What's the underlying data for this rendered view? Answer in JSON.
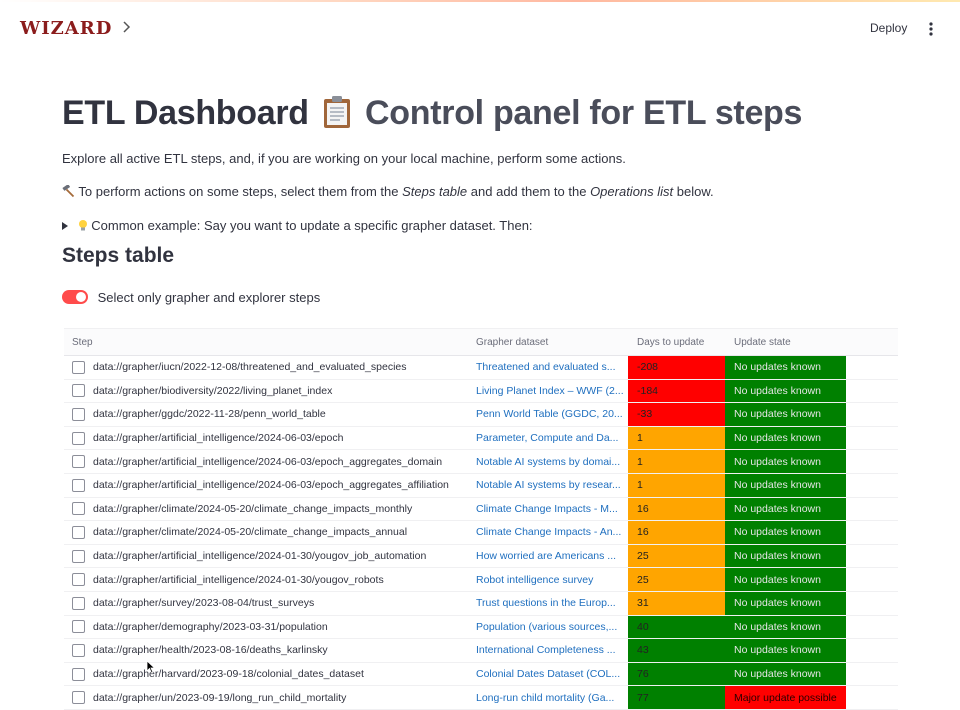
{
  "app": {
    "logo": "WIZARD",
    "deploy_label": "Deploy"
  },
  "page": {
    "title_left": "ETL Dashboard",
    "title_right": "Control panel for ETL steps",
    "intro": "Explore all active ETL steps, and, if you are working on your local machine, perform some actions.",
    "actions_prefix": "To perform actions on some steps, select them from the",
    "actions_steps_table": "Steps table",
    "actions_middle": "and add them to the",
    "actions_operations_list": "Operations list",
    "actions_suffix": "below.",
    "expander_label": "Common example: Say you want to update a specific grapher dataset. Then:",
    "steps_heading": "Steps table",
    "toggle_label": "Select only grapher and explorer steps",
    "toggle_on": true
  },
  "table": {
    "columns": [
      "Step",
      "Grapher dataset",
      "Days to update",
      "Update state"
    ],
    "rows": [
      {
        "step": "data://grapher/iucn/2022-12-08/threatened_and_evaluated_species",
        "grapher": "Threatened and evaluated s...",
        "days": "-208",
        "days_color": "#ff0000",
        "state": "No updates known",
        "state_color": "#008000"
      },
      {
        "step": "data://grapher/biodiversity/2022/living_planet_index",
        "grapher": "Living Planet Index – WWF (2...",
        "days": "-184",
        "days_color": "#ff0000",
        "state": "No updates known",
        "state_color": "#008000"
      },
      {
        "step": "data://grapher/ggdc/2022-11-28/penn_world_table",
        "grapher": "Penn World Table (GGDC, 20...",
        "days": "-33",
        "days_color": "#ff0000",
        "state": "No updates known",
        "state_color": "#008000"
      },
      {
        "step": "data://grapher/artificial_intelligence/2024-06-03/epoch",
        "grapher": "Parameter, Compute and Da...",
        "days": "1",
        "days_color": "#ffa500",
        "state": "No updates known",
        "state_color": "#008000"
      },
      {
        "step": "data://grapher/artificial_intelligence/2024-06-03/epoch_aggregates_domain",
        "grapher": "Notable AI systems by domai...",
        "days": "1",
        "days_color": "#ffa500",
        "state": "No updates known",
        "state_color": "#008000"
      },
      {
        "step": "data://grapher/artificial_intelligence/2024-06-03/epoch_aggregates_affiliation",
        "grapher": "Notable AI systems by resear...",
        "days": "1",
        "days_color": "#ffa500",
        "state": "No updates known",
        "state_color": "#008000"
      },
      {
        "step": "data://grapher/climate/2024-05-20/climate_change_impacts_monthly",
        "grapher": "Climate Change Impacts - M...",
        "days": "16",
        "days_color": "#ffa500",
        "state": "No updates known",
        "state_color": "#008000"
      },
      {
        "step": "data://grapher/climate/2024-05-20/climate_change_impacts_annual",
        "grapher": "Climate Change Impacts - An...",
        "days": "16",
        "days_color": "#ffa500",
        "state": "No updates known",
        "state_color": "#008000"
      },
      {
        "step": "data://grapher/artificial_intelligence/2024-01-30/yougov_job_automation",
        "grapher": "How worried are Americans ...",
        "days": "25",
        "days_color": "#ffa500",
        "state": "No updates known",
        "state_color": "#008000"
      },
      {
        "step": "data://grapher/artificial_intelligence/2024-01-30/yougov_robots",
        "grapher": "Robot intelligence survey",
        "days": "25",
        "days_color": "#ffa500",
        "state": "No updates known",
        "state_color": "#008000"
      },
      {
        "step": "data://grapher/survey/2023-08-04/trust_surveys",
        "grapher": "Trust questions in the Europ...",
        "days": "31",
        "days_color": "#ffa500",
        "state": "No updates known",
        "state_color": "#008000"
      },
      {
        "step": "data://grapher/demography/2023-03-31/population",
        "grapher": "Population (various sources,...",
        "days": "40",
        "days_color": "#008000",
        "state": "No updates known",
        "state_color": "#008000"
      },
      {
        "step": "data://grapher/health/2023-08-16/deaths_karlinsky",
        "grapher": "International Completeness ...",
        "days": "43",
        "days_color": "#008000",
        "state": "No updates known",
        "state_color": "#008000"
      },
      {
        "step": "data://grapher/harvard/2023-09-18/colonial_dates_dataset",
        "grapher": "Colonial Dates Dataset (COL...",
        "days": "76",
        "days_color": "#008000",
        "state": "No updates known",
        "state_color": "#008000"
      },
      {
        "step": "data://grapher/un/2023-09-19/long_run_child_mortality",
        "grapher": "Long-run child mortality (Ga...",
        "days": "77",
        "days_color": "#008000",
        "state": "Major update possible",
        "state_color": "#ff0000"
      }
    ]
  }
}
